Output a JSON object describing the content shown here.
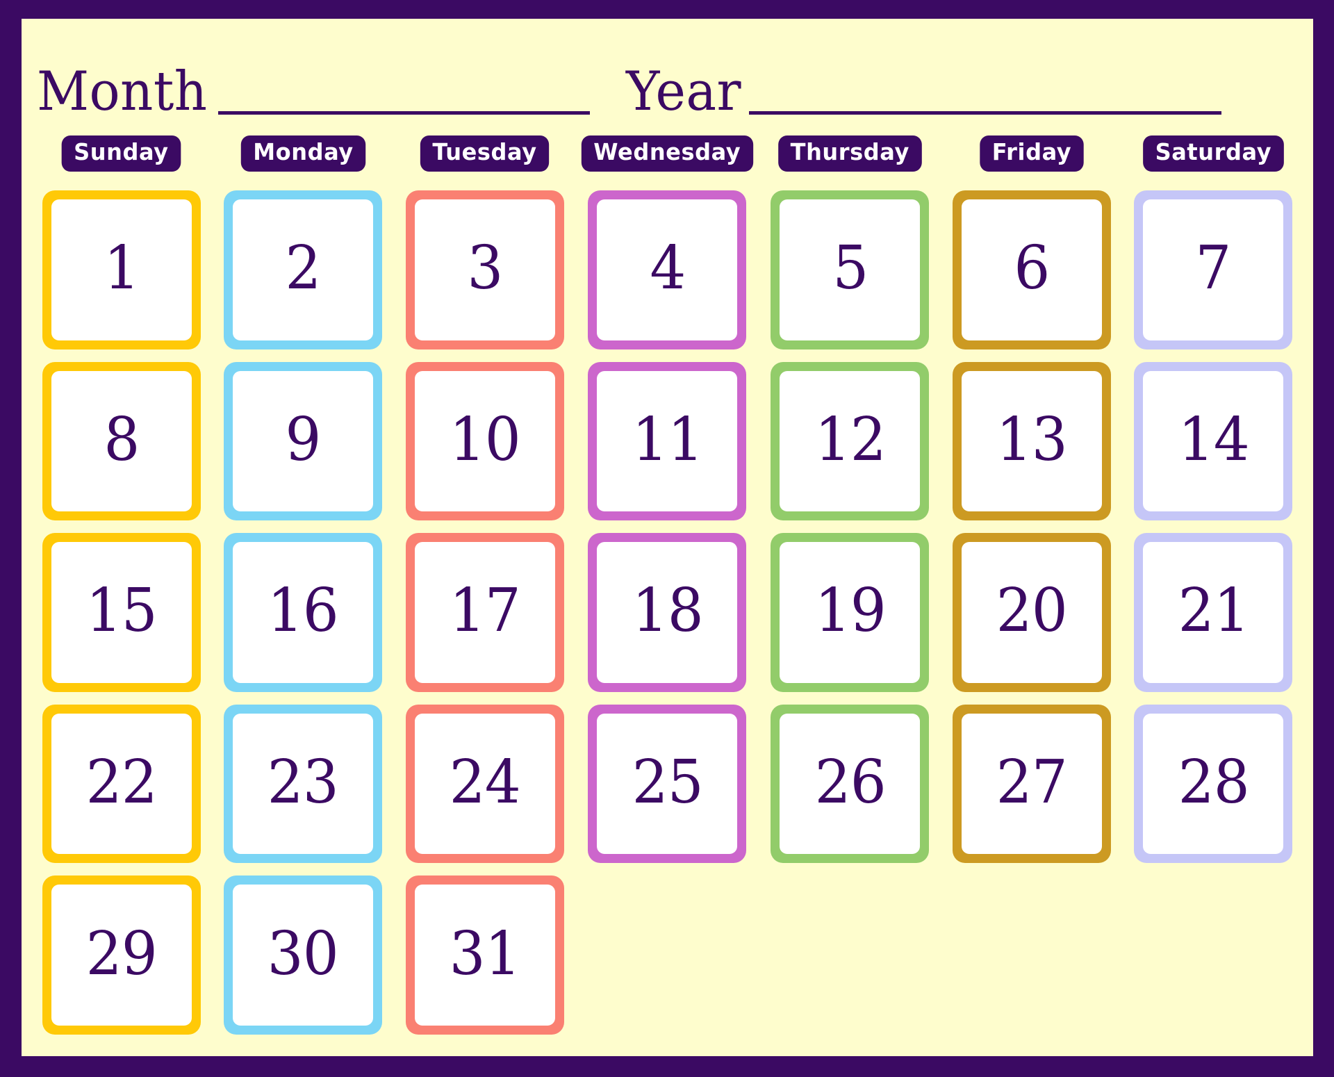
{
  "theme": {
    "border_color": "#3b0a63",
    "page_background": "#fefdcd",
    "ink_color": "#3b0a63",
    "tile_inner_color": "#ffffff"
  },
  "header": {
    "month_label": "Month",
    "month_blank_value": "",
    "year_label": "Year",
    "year_blank_value": ""
  },
  "weekdays": [
    {
      "label": "Sunday",
      "color": "#ffc907"
    },
    {
      "label": "Monday",
      "color": "#7bd5f5"
    },
    {
      "label": "Tuesday",
      "color": "#fa8072"
    },
    {
      "label": "Wednesday",
      "color": "#cc66cc"
    },
    {
      "label": "Thursday",
      "color": "#92cc6a"
    },
    {
      "label": "Friday",
      "color": "#cc9a22"
    },
    {
      "label": "Saturday",
      "color": "#c5c6f7"
    }
  ],
  "weeks": [
    [
      "1",
      "2",
      "3",
      "4",
      "5",
      "6",
      "7"
    ],
    [
      "8",
      "9",
      "10",
      "11",
      "12",
      "13",
      "14"
    ],
    [
      "15",
      "16",
      "17",
      "18",
      "19",
      "20",
      "21"
    ],
    [
      "22",
      "23",
      "24",
      "25",
      "26",
      "27",
      "28"
    ],
    [
      "29",
      "30",
      "31",
      "",
      "",
      "",
      ""
    ]
  ]
}
